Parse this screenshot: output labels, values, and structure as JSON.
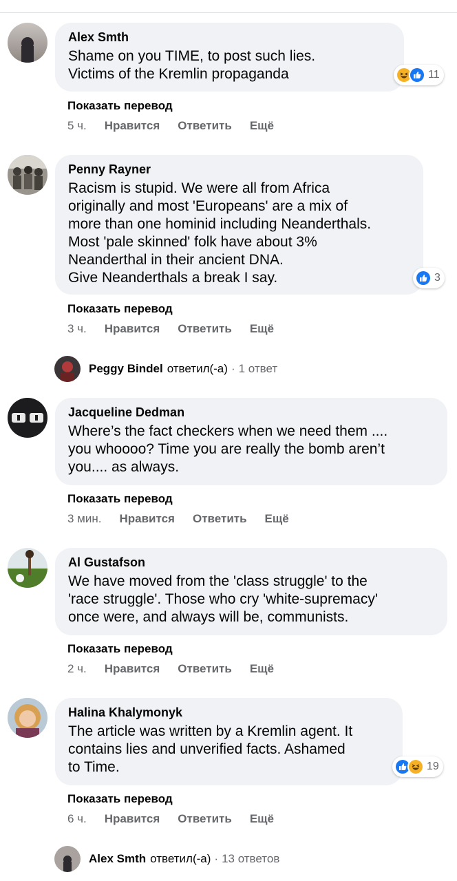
{
  "comments": [
    {
      "author": "Alex Smth",
      "text": "Shame on you TIME, to post such lies.\nVictims of the Kremlin propaganda",
      "translate": "Показать перевод",
      "time": "5 ч.",
      "like": "Нравится",
      "reply": "Ответить",
      "more": "Ещё",
      "reactions_count": "11",
      "reaction_icons": [
        "haha-icon",
        "like-icon"
      ]
    },
    {
      "author": "Penny Rayner",
      "text": "Racism is stupid. We were all from Africa\noriginally and most 'Europeans' are a mix of\nmore than one hominid including Neanderthals.\nMost 'pale skinned' folk have about 3%\nNeanderthal in their ancient DNA.\nGive Neanderthals a break I say.",
      "translate": "Показать перевод",
      "time": "3 ч.",
      "like": "Нравится",
      "reply": "Ответить",
      "more": "Ещё",
      "reactions_count": "3",
      "reaction_icons": [
        "like-icon"
      ]
    },
    {
      "author": "Jacqueline Dedman",
      "text": "Where’s the fact checkers when we need them ....\nyou whoooo? Time you are really the bomb aren’t\nyou.... as always.",
      "translate": "Показать перевод",
      "time": "3 мин.",
      "like": "Нравится",
      "reply": "Ответить",
      "more": "Ещё"
    },
    {
      "author": "Al Gustafson",
      "text": "We have moved from the 'class struggle' to the\n'race struggle'. Those who cry 'white-supremacy'\nonce were, and always will be, communists.",
      "translate": "Показать перевод",
      "time": "2 ч.",
      "like": "Нравится",
      "reply": "Ответить",
      "more": "Ещё"
    },
    {
      "author": "Halina Khalymonyk",
      "text": "The article was written by a Kremlin agent. It\ncontains lies and unverified facts. Ashamed\nto Time.",
      "translate": "Показать перевод",
      "time": "6 ч.",
      "like": "Нравится",
      "reply": "Ответить",
      "more": "Ещё",
      "reactions_count": "19",
      "reaction_icons": [
        "like-icon",
        "haha-icon"
      ]
    }
  ],
  "replies": [
    {
      "name": "Peggy Bindel",
      "verb": "ответил(-а)",
      "dot": "·",
      "count": "1 ответ"
    },
    {
      "name": "Alex Smth",
      "verb": "ответил(-а)",
      "dot": "·",
      "count": "13 ответов"
    }
  ],
  "colors": {
    "bubble": "#f0f2f5",
    "meta_text": "#65676b",
    "like_blue": "#1877f2",
    "haha_yellow": "#f7b125"
  }
}
